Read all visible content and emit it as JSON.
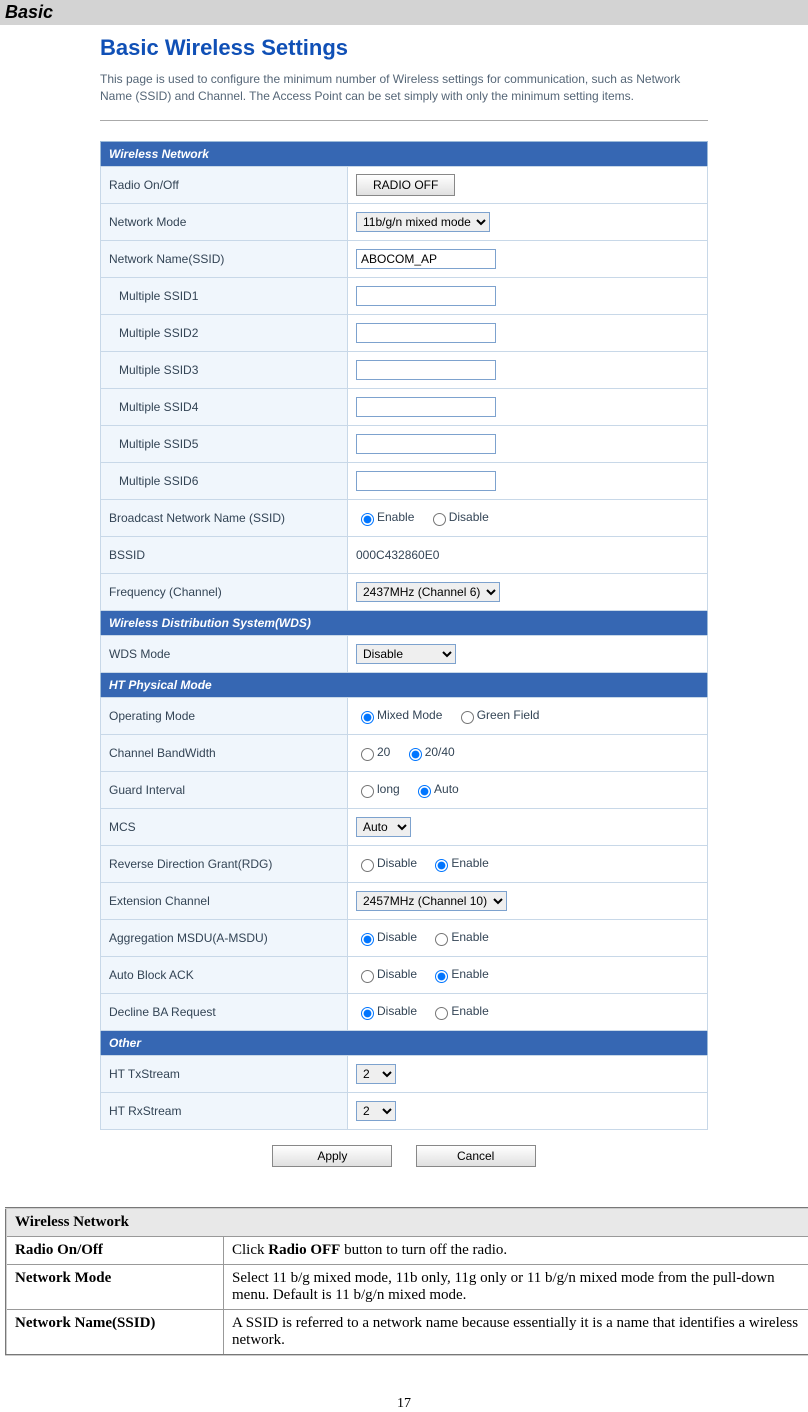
{
  "heading": "Basic",
  "pageTitle": "Basic Wireless Settings",
  "pageDesc": "This page is used to configure the minimum number of Wireless settings for communication, such as Network Name (SSID) and Channel. The Access Point can be set simply with only the minimum setting items.",
  "sections": {
    "wirelessNetwork": "Wireless Network",
    "wds": "Wireless Distribution System(WDS)",
    "htPhysical": "HT Physical Mode",
    "other": "Other"
  },
  "labels": {
    "radioOnOff": "Radio On/Off",
    "networkMode": "Network Mode",
    "networkName": "Network Name(SSID)",
    "ssid1": "Multiple SSID1",
    "ssid2": "Multiple SSID2",
    "ssid3": "Multiple SSID3",
    "ssid4": "Multiple SSID4",
    "ssid5": "Multiple SSID5",
    "ssid6": "Multiple SSID6",
    "broadcast": "Broadcast Network Name (SSID)",
    "bssid": "BSSID",
    "frequency": "Frequency (Channel)",
    "wdsMode": "WDS Mode",
    "operatingMode": "Operating Mode",
    "channelBandwidth": "Channel BandWidth",
    "guardInterval": "Guard Interval",
    "mcs": "MCS",
    "rdg": "Reverse Direction Grant(RDG)",
    "extensionChannel": "Extension Channel",
    "amsdu": "Aggregation MSDU(A-MSDU)",
    "autoBlockAck": "Auto Block ACK",
    "declineBa": "Decline BA Request",
    "htTxStream": "HT TxStream",
    "htRxStream": "HT RxStream"
  },
  "values": {
    "radioOffBtn": "RADIO OFF",
    "networkMode": "11b/g/n mixed mode",
    "ssid": "ABOCOM_AP",
    "enable": "Enable",
    "disable": "Disable",
    "bssid": "000C432860E0",
    "frequency": "2437MHz (Channel 6)",
    "wdsMode": "Disable",
    "mixedMode": "Mixed Mode",
    "greenField": "Green Field",
    "bw20": "20",
    "bw2040": "20/40",
    "long": "long",
    "auto": "Auto",
    "mcs": "Auto",
    "extensionChannel": "2457MHz (Channel 10)",
    "txStream": "2",
    "rxStream": "2",
    "apply": "Apply",
    "cancel": "Cancel"
  },
  "doc": {
    "header": "Wireless Network",
    "rows": [
      {
        "label": "Radio On/Off",
        "desc": "Click Radio OFF button to turn off the radio.",
        "boldPart": "Radio OFF"
      },
      {
        "label": "Network Mode",
        "desc": "Select 11 b/g mixed mode, 11b only, 11g only or 11 b/g/n mixed mode from the pull-down menu. Default is 11 b/g/n mixed mode."
      },
      {
        "label": "Network Name(SSID)",
        "desc": "A SSID is referred to a network name because essentially it is a name that identifies a wireless network."
      }
    ]
  },
  "pageNum": "17"
}
